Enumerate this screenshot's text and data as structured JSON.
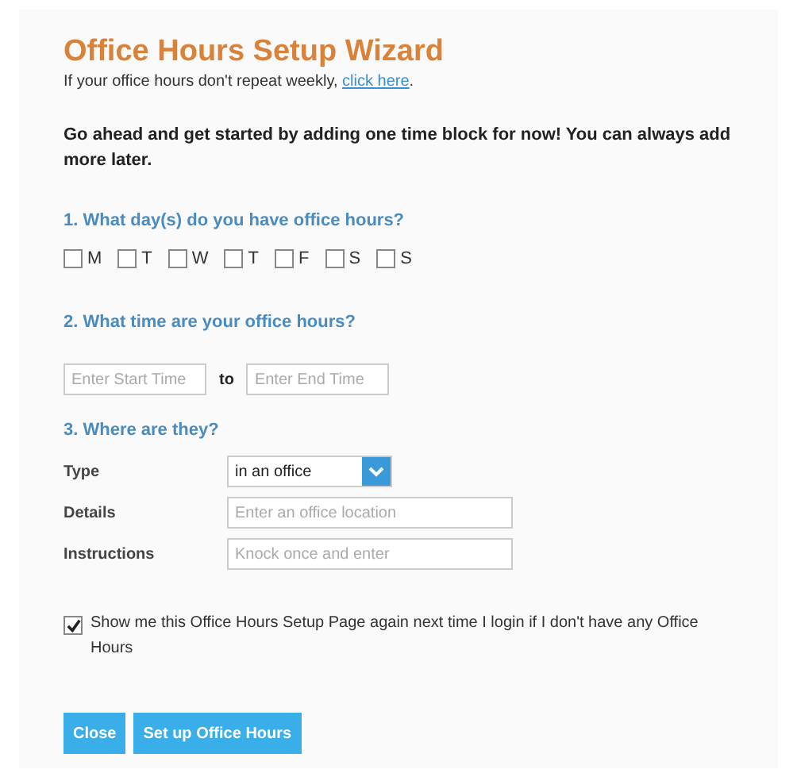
{
  "title": "Office Hours Setup Wizard",
  "subtitle": {
    "text": "If your office hours don't repeat weekly, ",
    "link": "click here",
    "end": "."
  },
  "intro": "Go ahead and get started by adding one time block for now! You can always add more later.",
  "days": {
    "question": "1. What day(s) do you have office hours?",
    "items": [
      {
        "label": "M",
        "checked": false
      },
      {
        "label": "T",
        "checked": false
      },
      {
        "label": "W",
        "checked": false
      },
      {
        "label": "T",
        "checked": false
      },
      {
        "label": "F",
        "checked": false
      },
      {
        "label": "S",
        "checked": false
      },
      {
        "label": "S",
        "checked": false
      }
    ]
  },
  "time": {
    "question": "2. What time are your office hours?",
    "start": {
      "placeholder": "Enter Start Time"
    },
    "separator": "to",
    "end": {
      "placeholder": "Enter End Time"
    }
  },
  "location": {
    "question": "3. Where are they?",
    "fields": [
      {
        "kind": "select",
        "label": "Type",
        "value": "in an office"
      },
      {
        "kind": "text",
        "label": "Details",
        "placeholder": "Enter an office location"
      },
      {
        "kind": "text",
        "label": "Instructions",
        "placeholder": "Knock once and enter"
      }
    ]
  },
  "show_again": {
    "label": "Show me this Office Hours Setup Page again next time I login if I don't have any Office Hours",
    "checked": true
  },
  "buttons": [
    "Close",
    "Set up Office Hours"
  ]
}
